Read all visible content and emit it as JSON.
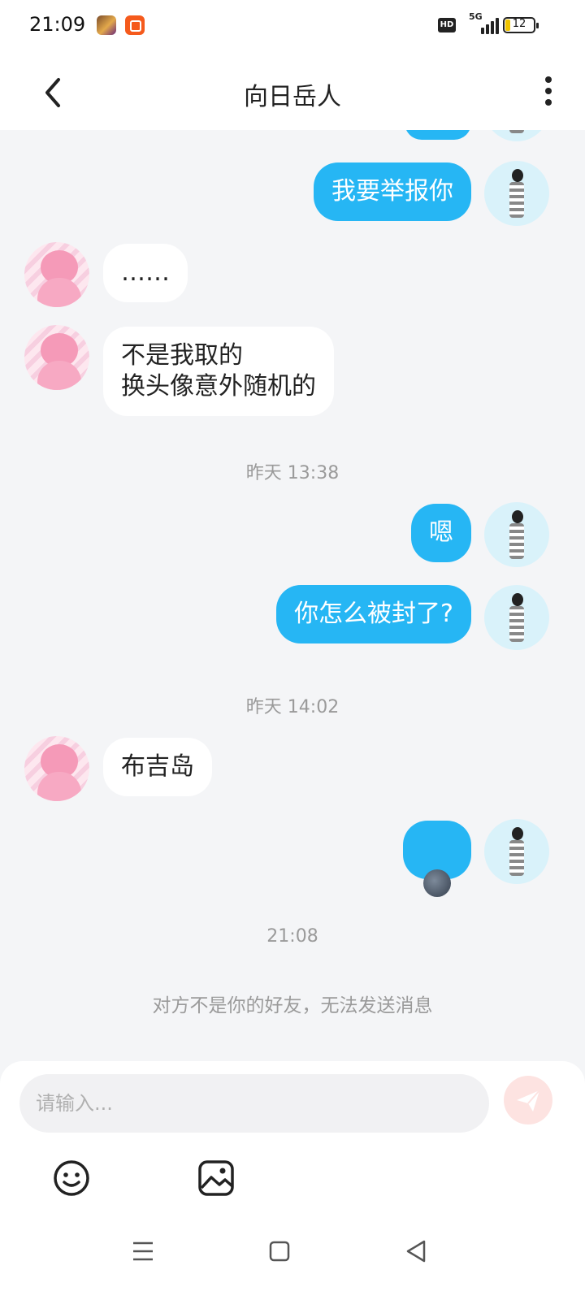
{
  "status_bar": {
    "time": "21:09",
    "network": "5G",
    "hd": "HD",
    "battery": "12"
  },
  "header": {
    "title": "向日岳人",
    "back_icon": "chevron-left-icon",
    "more_icon": "more-vertical-icon"
  },
  "messages": [
    {
      "sender": "me",
      "text": "我要举报你"
    },
    {
      "sender": "other",
      "text": "……"
    },
    {
      "sender": "other",
      "text": "不是我取的\n换头像意外随机的"
    },
    {
      "type": "timestamp",
      "text": "昨天 13:38"
    },
    {
      "sender": "me",
      "text": "嗯"
    },
    {
      "sender": "me",
      "text": "你怎么被封了?"
    },
    {
      "type": "timestamp",
      "text": "昨天 14:02"
    },
    {
      "sender": "other",
      "text": "布吉岛"
    },
    {
      "sender": "me",
      "emoji": "new-moon-face"
    },
    {
      "type": "timestamp",
      "text": "21:08"
    }
  ],
  "notice": "对方不是你的好友，无法发送消息",
  "composer": {
    "placeholder": "请输入...",
    "send_icon": "send-icon",
    "emoji_icon": "smiley-icon",
    "image_icon": "image-icon"
  },
  "colors": {
    "outgoing_bubble": "#26b6f4",
    "incoming_bubble": "#ffffff",
    "background": "#f4f5f7",
    "send_button": "#fde3e1"
  }
}
